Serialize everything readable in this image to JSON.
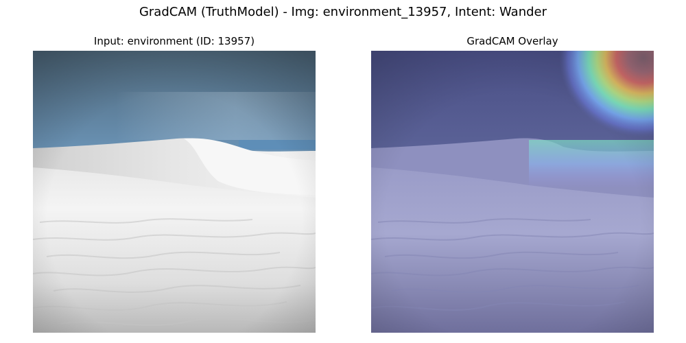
{
  "figure": {
    "suptitle": "GradCAM (TruthModel) - Img: environment_13957, Intent: Wander"
  },
  "panels": [
    {
      "title": "Input: environment (ID: 13957)",
      "image_subject": "white sand dunes under blue sky"
    },
    {
      "title": "GradCAM Overlay",
      "image_subject": "same scene with jet-colormap heatmap overlay, hotspot in upper-right"
    }
  ],
  "colors": {
    "sky_top": "#4f6f86",
    "sky_mid": "#6f98bb",
    "sand_light": "#f2f2f2",
    "sand_shadow": "#c9c9c9",
    "overlay_base": "#5e66a6",
    "heat_hot": "#c66a73",
    "heat_warm": "#e3d16a",
    "heat_mid": "#7fe0a8",
    "heat_cool": "#6ea7ef"
  }
}
